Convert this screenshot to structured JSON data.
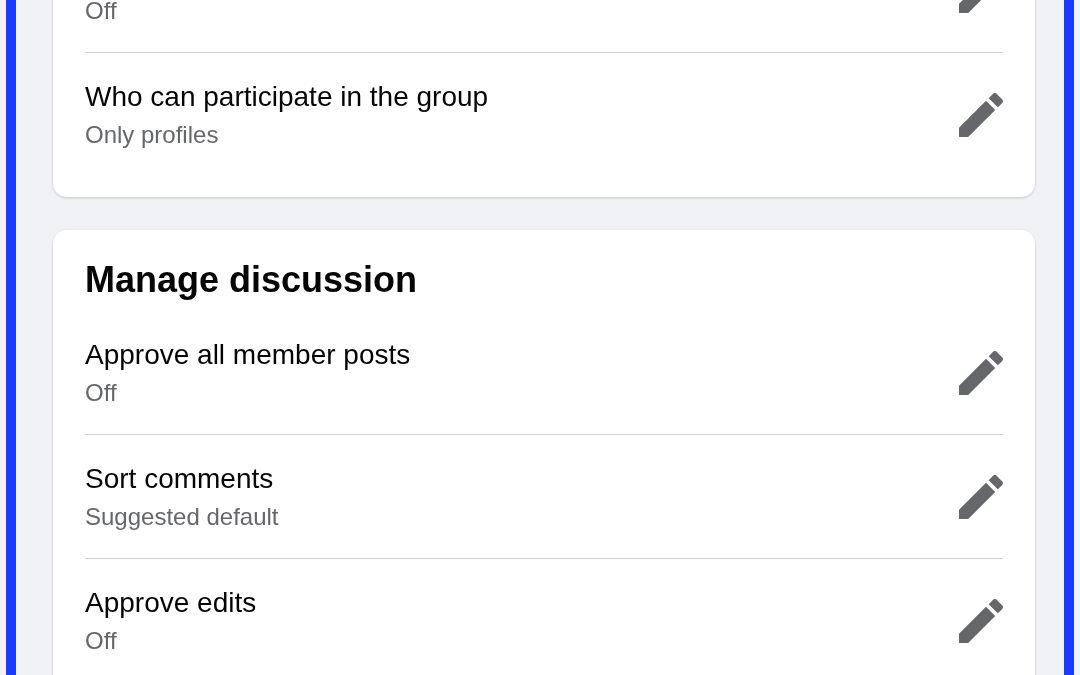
{
  "sections": [
    {
      "rows": [
        {
          "value": "Off"
        },
        {
          "label": "Who can participate in the group",
          "value": "Only profiles"
        }
      ]
    },
    {
      "title": "Manage discussion",
      "rows": [
        {
          "label": "Approve all member posts",
          "value": "Off"
        },
        {
          "label": "Sort comments",
          "value": "Suggested default"
        },
        {
          "label": "Approve edits",
          "value": "Off"
        }
      ]
    }
  ]
}
